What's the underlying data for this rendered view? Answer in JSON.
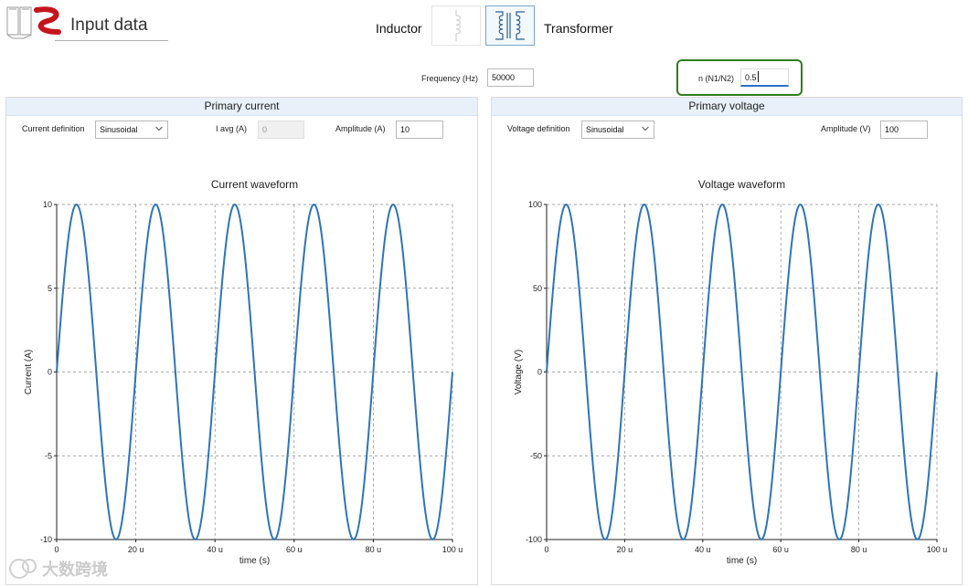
{
  "app": {
    "title": "Input data"
  },
  "mode_selector": {
    "inductor_label": "Inductor",
    "transformer_label": "Transformer",
    "selected": "Transformer",
    "inductor_icon": "inductor-coil-icon",
    "transformer_icon": "transformer-icon"
  },
  "global_inputs": {
    "frequency_label": "Frequency (Hz)",
    "frequency_value": "50000",
    "n_label": "n (N1/N2)",
    "n_value": "0.5",
    "highlight_color": "#2f7d1e"
  },
  "primary_current": {
    "header": "Primary current",
    "definition_label": "Current definition",
    "definition_value": "Sinusoidal",
    "iavg_label": "I avg (A)",
    "iavg_value": "0",
    "amplitude_label": "Amplitude (A)",
    "amplitude_value": "10"
  },
  "primary_voltage": {
    "header": "Primary voltage",
    "definition_label": "Voltage definition",
    "definition_value": "Sinusoidal",
    "amplitude_label": "Amplitude (V)",
    "amplitude_value": "100"
  },
  "chart_data": [
    {
      "type": "line",
      "title": "Current waveform",
      "xlabel": "time (s)",
      "ylabel": "Current (A)",
      "xlim": [
        0,
        100
      ],
      "ylim": [
        -10,
        10
      ],
      "x_ticks": [
        0,
        20,
        40,
        60,
        80,
        100
      ],
      "x_tick_labels": [
        "0",
        "20 u",
        "40 u",
        "60 u",
        "80 u",
        "100 u"
      ],
      "y_ticks": [
        10,
        5,
        0,
        -5,
        -10
      ],
      "y_tick_labels": [
        "10",
        "5",
        "0",
        "-5",
        "-10"
      ],
      "grid": true,
      "series": [
        {
          "function": "sine",
          "amplitude": 10,
          "period": 20,
          "color": "#2e75b6"
        }
      ]
    },
    {
      "type": "line",
      "title": "Voltage waveform",
      "xlabel": "time (s)",
      "ylabel": "Voltage (V)",
      "xlim": [
        0,
        100
      ],
      "ylim": [
        -100,
        100
      ],
      "x_ticks": [
        0,
        20,
        40,
        60,
        80,
        100
      ],
      "x_tick_labels": [
        "0",
        "20 u",
        "40 u",
        "60 u",
        "80 u",
        "100 u"
      ],
      "y_ticks": [
        100,
        50,
        0,
        -50,
        -100
      ],
      "y_tick_labels": [
        "100",
        "50",
        "0",
        "-50",
        "-100"
      ],
      "grid": true,
      "series": [
        {
          "function": "sine",
          "amplitude": 100,
          "period": 20,
          "color": "#2e75b6"
        }
      ]
    }
  ],
  "watermark": {
    "text": "大数跨境"
  }
}
